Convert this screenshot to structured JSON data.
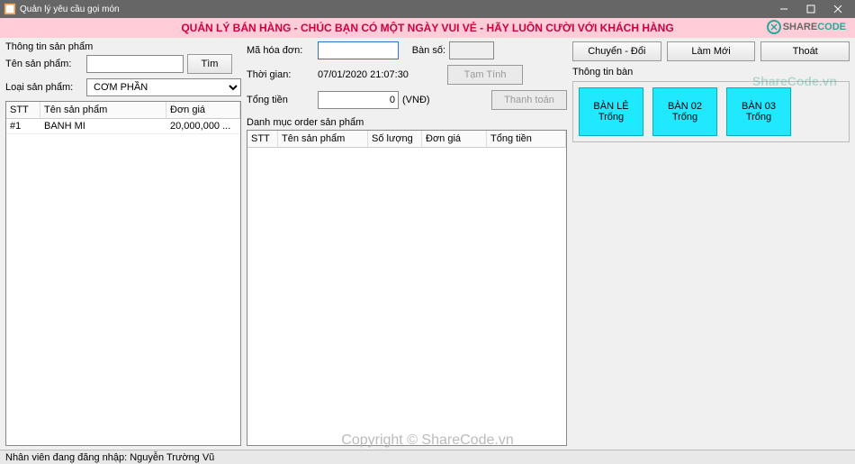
{
  "titlebar": {
    "text": "Quản lý yêu cầu gọi món"
  },
  "banner": {
    "msg": "QUẢN LÝ BÁN HÀNG - CHÚC BẠN CÓ MỘT NGÀY VUI VẺ - HÃY LUÔN CƯỜI VỚI KHÁCH HÀNG",
    "logo1": "SHARE",
    "logo2": "CODE"
  },
  "left": {
    "title": "Thông tin sản phẩm",
    "name_label": "Tên sản phẩm:",
    "name_value": "",
    "find_btn": "Tìm",
    "type_label": "Loại sản phẩm:",
    "type_value": "CƠM PHẦN",
    "cols": {
      "stt": "STT",
      "ten": "Tên sản phẩm",
      "don": "Đơn giá"
    },
    "rows": [
      {
        "stt": "#1",
        "ten": "BANH MI",
        "don": "20,000,000 ..."
      }
    ]
  },
  "center": {
    "mhd_label": "Mã hóa đơn:",
    "mhd_value": "",
    "ban_label": "Bàn số:",
    "ban_value": "",
    "tg_label": "Thời gian:",
    "tg_value": "07/01/2020 21:07:30",
    "tt_label": "Tổng tiền",
    "tt_value": "0",
    "vnd": "(VNĐ)",
    "tamtinh": "Tạm Tính",
    "thanhtoan": "Thanh toán",
    "order_title": "Danh mục order sản phẩm",
    "cols": {
      "stt": "STT",
      "ten": "Tên sản phẩm",
      "sl": "Số lượng",
      "dg": "Đơn giá",
      "tong": "Tổng tiền"
    }
  },
  "right": {
    "chuyen": "Chuyển - Đổi",
    "lammoi": "Làm Mới",
    "thoat": "Thoát",
    "title": "Thông tin bàn",
    "tables": [
      {
        "name": "BÀN LẺ",
        "status": "Trống"
      },
      {
        "name": "BÀN 02",
        "status": "Trống"
      },
      {
        "name": "BÀN 03",
        "status": "Trống"
      }
    ]
  },
  "status": {
    "text": "Nhân viên đang đăng nhập: Nguyễn Trường Vũ"
  },
  "wm": {
    "center": "Copyright © ShareCode.vn",
    "side": "ShareCode.vn"
  }
}
